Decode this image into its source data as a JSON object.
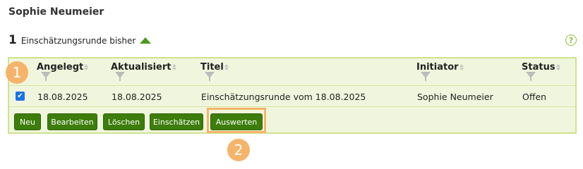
{
  "header": {
    "user_name": "Sophie Neumeier"
  },
  "summary": {
    "count": "1",
    "label": "Einschätzungsrunde bisher"
  },
  "help": {
    "symbol": "?"
  },
  "table": {
    "columns": [
      "Angelegt",
      "Aktualisiert",
      "Titel",
      "Initiator",
      "Status"
    ],
    "rows": [
      {
        "checked": true,
        "angelegt": "18.08.2025",
        "aktualisiert": "18.08.2025",
        "titel": "Einschätzungsrunde vom 18.08.2025",
        "initiator": "Sophie Neumeier",
        "status": "Offen"
      }
    ]
  },
  "buttons": {
    "new": "Neu",
    "edit": "Bearbeiten",
    "delete": "Löschen",
    "assess": "Einschätzen",
    "evaluate": "Auswerten"
  },
  "annotations": {
    "step1": "1",
    "step2": "2"
  },
  "colors": {
    "accent_green": "#3d7d0c",
    "grid_border": "#cfe28f",
    "grid_bg": "#f0f6dd",
    "callout_orange": "#f5b46a"
  },
  "icons": {
    "sort": "sort-arrows-icon",
    "filter": "filter-funnel-icon",
    "trend": "arrow-up-icon",
    "help": "help-icon"
  }
}
